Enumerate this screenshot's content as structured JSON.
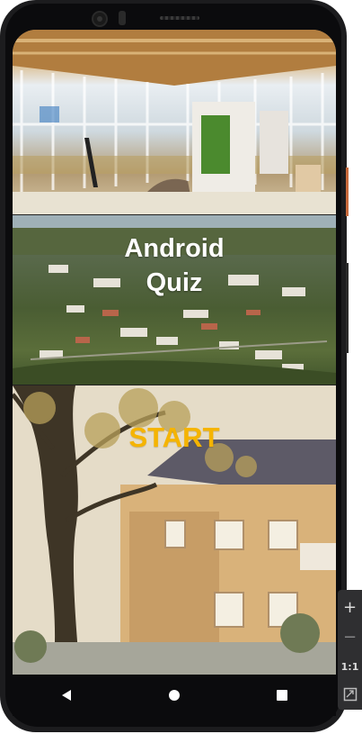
{
  "app": {
    "title": "Android Quiz",
    "start_label": "START"
  },
  "navbar": {
    "back_icon": "back-triangle-icon",
    "home_icon": "home-circle-icon",
    "recents_icon": "recents-square-icon"
  },
  "emulator_controls": {
    "zoom_in_label": "+",
    "zoom_out_label": "−",
    "actual_size_label": "1:1",
    "fit_icon": "fit-screen-icon"
  },
  "colors": {
    "title_text": "#ffffff",
    "start_text": "#f5b400",
    "navbar_bg": "#0b0b0d",
    "phone_frame": "#1c1c1e"
  }
}
